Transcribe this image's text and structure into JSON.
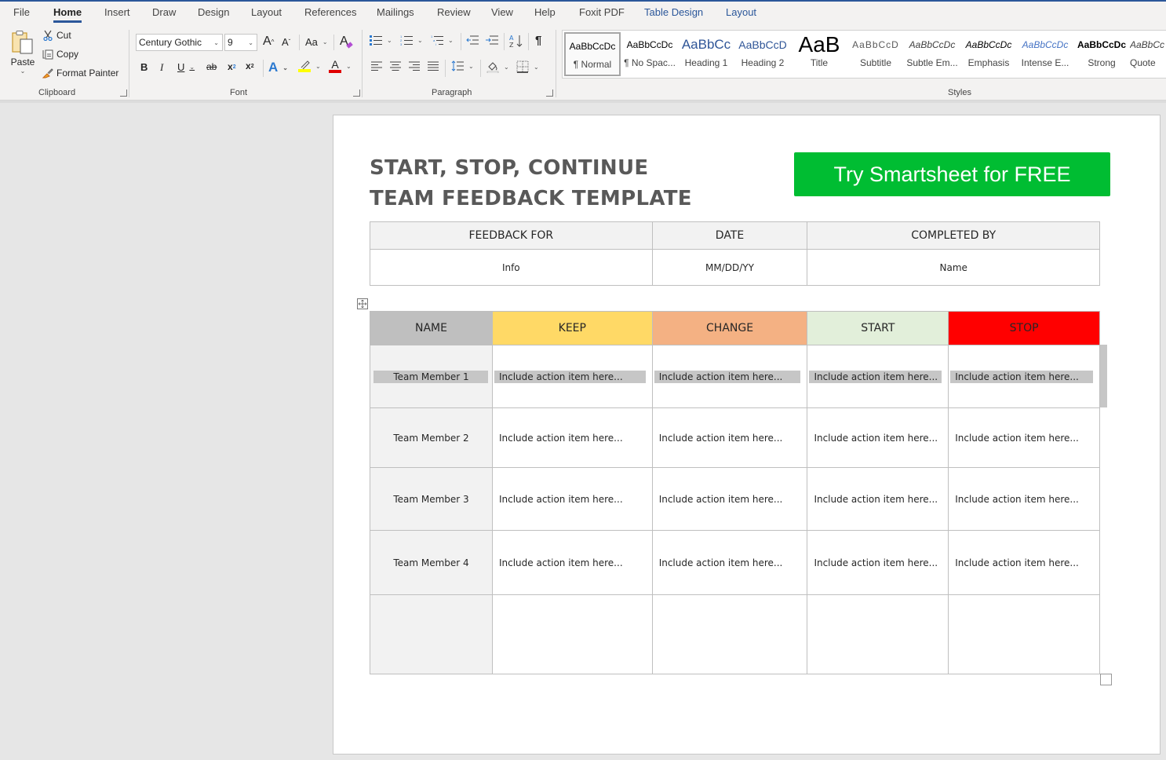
{
  "ribbon": {
    "tabs": [
      {
        "label": "File",
        "active": false
      },
      {
        "label": "Home",
        "active": true
      },
      {
        "label": "Insert",
        "active": false
      },
      {
        "label": "Draw",
        "active": false
      },
      {
        "label": "Design",
        "active": false
      },
      {
        "label": "Layout",
        "active": false
      },
      {
        "label": "References",
        "active": false
      },
      {
        "label": "Mailings",
        "active": false
      },
      {
        "label": "Review",
        "active": false
      },
      {
        "label": "View",
        "active": false
      },
      {
        "label": "Help",
        "active": false
      },
      {
        "label": "Foxit PDF",
        "active": false
      },
      {
        "label": "Table Design",
        "active": false,
        "contextual": true
      },
      {
        "label": "Layout",
        "active": false,
        "contextual": true
      }
    ],
    "clipboard": {
      "label": "Clipboard",
      "paste": "Paste",
      "cut": "Cut",
      "copy": "Copy",
      "format_painter": "Format Painter"
    },
    "font": {
      "label": "Font",
      "font_name": "Century Gothic",
      "font_size": "9",
      "change_case": "Aa",
      "highlight_color": "#ffff00",
      "font_color": "#e00000"
    },
    "paragraph": {
      "label": "Paragraph"
    },
    "styles": {
      "label": "Styles",
      "items": [
        {
          "preview": "AaBbCcDc",
          "name": "¶ Normal"
        },
        {
          "preview": "AaBbCcDc",
          "name": "¶ No Spac..."
        },
        {
          "preview": "AaBbCc",
          "name": "Heading 1"
        },
        {
          "preview": "AaBbCcD",
          "name": "Heading 2"
        },
        {
          "preview": "AaB",
          "name": "Title"
        },
        {
          "preview": "AaBbCcD",
          "name": "Subtitle"
        },
        {
          "preview": "AaBbCcDc",
          "name": "Subtle Em..."
        },
        {
          "preview": "AaBbCcDc",
          "name": "Emphasis"
        },
        {
          "preview": "AaBbCcDc",
          "name": "Intense E..."
        },
        {
          "preview": "AaBbCcDc",
          "name": "Strong"
        },
        {
          "preview": "AaBbCc",
          "name": "Quote"
        }
      ]
    }
  },
  "document": {
    "title_line1": "START, STOP, CONTINUE",
    "title_line2": "TEAM FEEDBACK TEMPLATE",
    "cta_label": "Try Smartsheet for FREE",
    "cta_color": "#00bd32",
    "info_table": {
      "headers": [
        "FEEDBACK FOR",
        "DATE",
        "COMPLETED BY"
      ],
      "values": [
        "Info",
        "MM/DD/YY",
        "Name"
      ]
    },
    "feedback_table": {
      "headers": [
        {
          "label": "NAME",
          "color": "#bfbfbf"
        },
        {
          "label": "KEEP",
          "color": "#ffd966"
        },
        {
          "label": "CHANGE",
          "color": "#f4b183"
        },
        {
          "label": "START",
          "color": "#e2efda"
        },
        {
          "label": "STOP",
          "color": "#ff0000"
        }
      ],
      "rows": [
        {
          "name": "Team Member 1",
          "cells": [
            "Include action item here...",
            "Include action item here...",
            "Include action item here...",
            "Include action item here..."
          ],
          "selected": true
        },
        {
          "name": "Team Member 2",
          "cells": [
            "Include action item here...",
            "Include action item here...",
            "Include action item here...",
            "Include action item here..."
          ]
        },
        {
          "name": "Team Member 3",
          "cells": [
            "Include action item here...",
            "Include action item here...",
            "Include action item here...",
            "Include action item here..."
          ]
        },
        {
          "name": "Team Member 4",
          "cells": [
            "Include action item here...",
            "Include action item here...",
            "Include action item here...",
            "Include action item here..."
          ]
        },
        {
          "name": "",
          "cells": [
            "",
            "",
            "",
            ""
          ]
        }
      ]
    }
  }
}
